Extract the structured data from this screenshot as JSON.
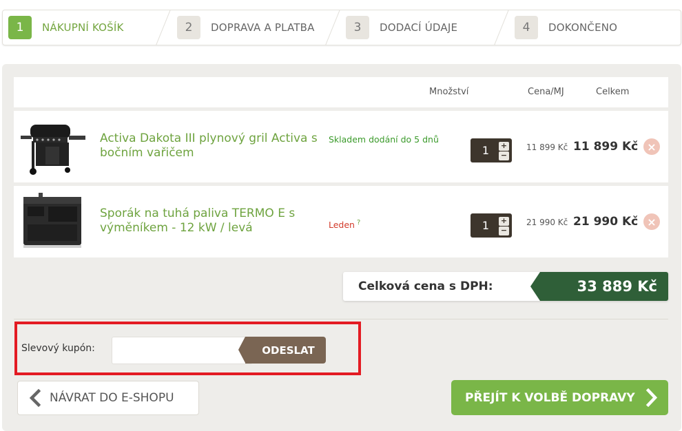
{
  "steps": [
    {
      "num": "1",
      "label": "NÁKUPNÍ KOŠÍK"
    },
    {
      "num": "2",
      "label": "DOPRAVA A PLATBA"
    },
    {
      "num": "3",
      "label": "DODACÍ ÚDAJE"
    },
    {
      "num": "4",
      "label": "DOKONČENO"
    }
  ],
  "cart": {
    "headers": {
      "quantity": "Množství",
      "unit_price": "Cena/MJ",
      "total": "Celkem"
    },
    "items": [
      {
        "name": "Activa Dakota III plynový gril Activa s bočním vařičem",
        "availability": "Skladem dodání do 5 dnů",
        "quantity": "1",
        "unit_price": "11 899 Kč",
        "total": "11 899 Kč"
      },
      {
        "name": "Sporák na tuhá paliva TERMO E s výměníkem - 12 kW / levá",
        "availability": "Leden",
        "availability_help": "?",
        "quantity": "1",
        "unit_price": "21 990 Kč",
        "total": "21 990 Kč"
      }
    ],
    "qty_plus": "+",
    "qty_minus": "−",
    "remove_symbol": "×"
  },
  "summary": {
    "label": "Celková cena s DPH:",
    "value": "33 889 Kč"
  },
  "coupon": {
    "label": "Slevový kupón:",
    "value": "",
    "button": "ODESLAT"
  },
  "nav": {
    "back": "NÁVRAT DO E-SHOPU",
    "next": "PŘEJÍT K VOLBĚ DOPRAVY"
  },
  "colors": {
    "accent_green": "#7ab648",
    "dark_green": "#2f5f38",
    "brown": "#7a6553",
    "highlight_red": "#e31b23"
  }
}
